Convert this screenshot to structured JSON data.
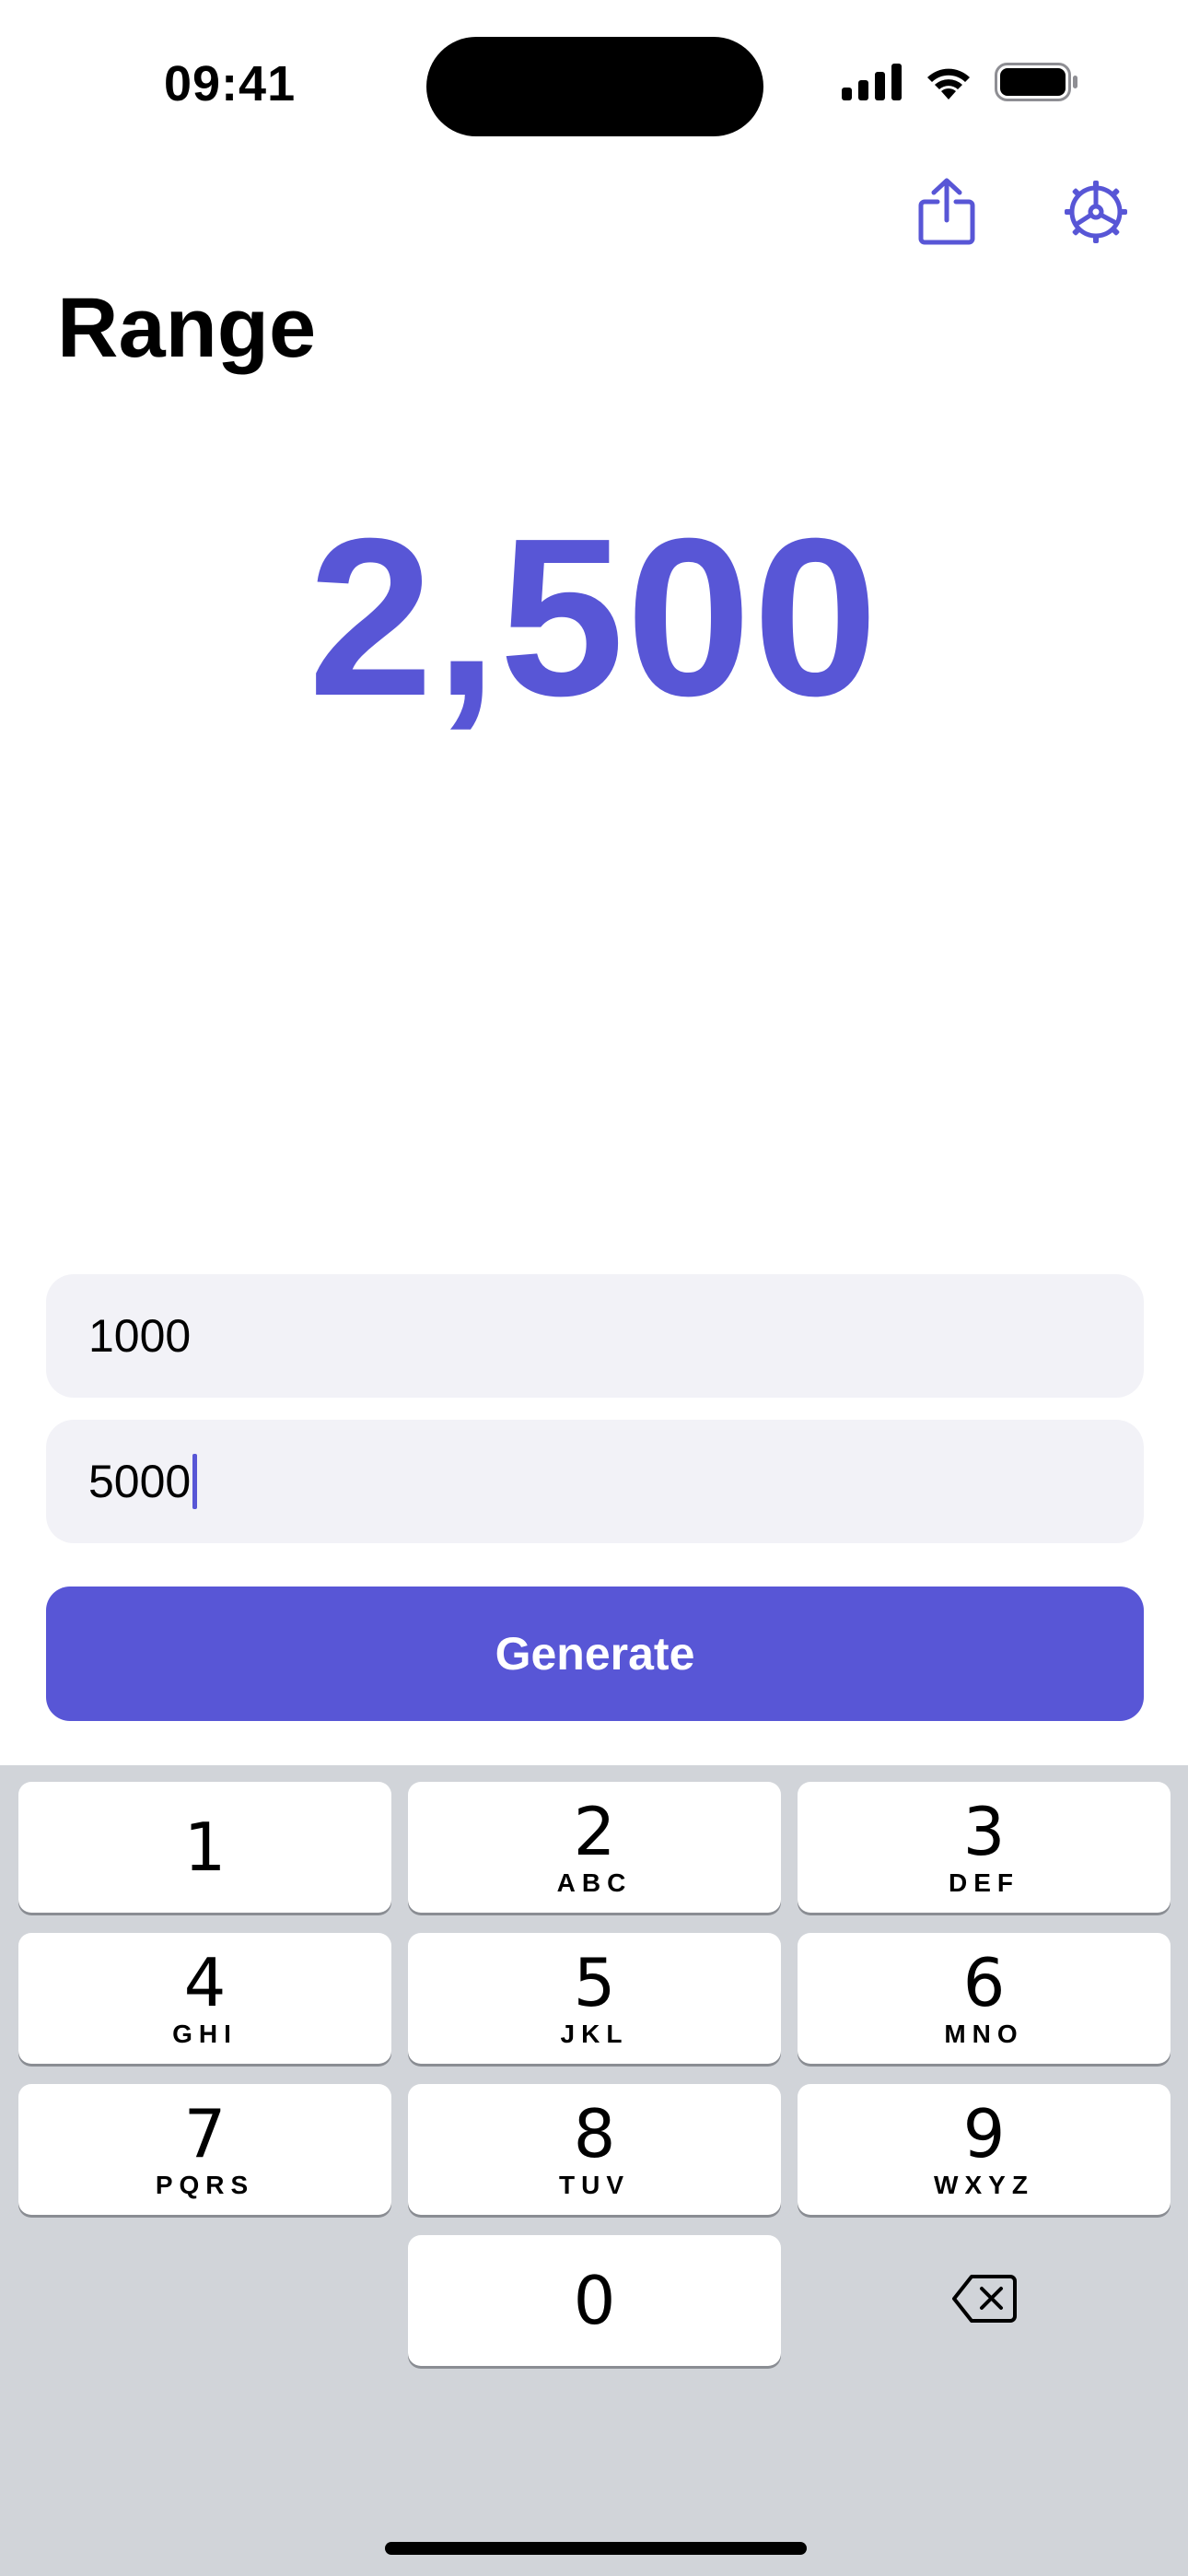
{
  "status_bar": {
    "time": "09:41"
  },
  "nav": {
    "share_icon": "share-icon",
    "settings_icon": "gear-icon"
  },
  "title": "Range",
  "result": "2,500",
  "inputs": {
    "min_value": "1000",
    "max_value": "5000"
  },
  "generate_label": "Generate",
  "keyboard": {
    "keys": [
      {
        "digit": "1",
        "letters": ""
      },
      {
        "digit": "2",
        "letters": "ABC"
      },
      {
        "digit": "3",
        "letters": "DEF"
      },
      {
        "digit": "4",
        "letters": "GHI"
      },
      {
        "digit": "5",
        "letters": "JKL"
      },
      {
        "digit": "6",
        "letters": "MNO"
      },
      {
        "digit": "7",
        "letters": "PQRS"
      },
      {
        "digit": "8",
        "letters": "TUV"
      },
      {
        "digit": "9",
        "letters": "WXYZ"
      },
      {
        "digit": "0",
        "letters": ""
      }
    ],
    "delete_icon": "delete-icon"
  },
  "colors": {
    "accent": "#5856d6",
    "field_background": "#f2f2f7",
    "keyboard_background": "#d1d4d9"
  }
}
